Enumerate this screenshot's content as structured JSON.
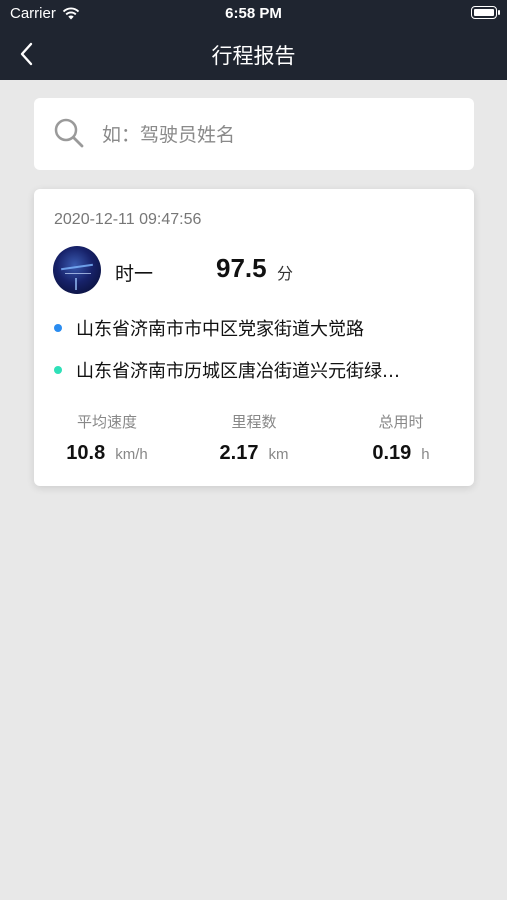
{
  "status_bar": {
    "carrier": "Carrier",
    "time": "6:58 PM"
  },
  "nav": {
    "title": "行程报告"
  },
  "search": {
    "placeholder": "如：驾驶员姓名"
  },
  "trip": {
    "datetime": "2020-12-11 09:47:56",
    "driver_name": "时一",
    "score": "97.5",
    "score_unit": "分",
    "start_address": "山东省济南市市中区党家街道大觉路",
    "end_address": "山东省济南市历城区唐冶街道兴元街绿…",
    "start_dot_color": "#2a8cf0",
    "end_dot_color": "#2fe0b8",
    "stats": [
      {
        "label": "平均速度",
        "value": "10.8",
        "unit": "km/h"
      },
      {
        "label": "里程数",
        "value": "2.17",
        "unit": "km"
      },
      {
        "label": "总用时",
        "value": "0.19",
        "unit": "h"
      }
    ]
  },
  "colors": {
    "header_bg": "#1f2530",
    "page_bg": "#e8e8e8",
    "card_bg": "#ffffff"
  },
  "icons": {
    "back": "chevron-left-icon",
    "search": "search-icon",
    "wifi": "wifi-icon",
    "battery": "battery-icon"
  }
}
